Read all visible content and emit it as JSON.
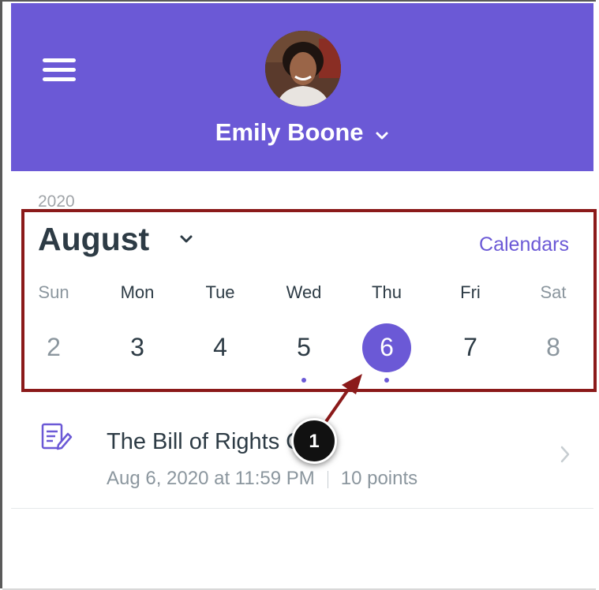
{
  "header": {
    "user_name": "Emily Boone",
    "accent_color": "#6b59d6"
  },
  "calendar": {
    "year": "2020",
    "month": "August",
    "calendars_label": "Calendars",
    "weekdays": [
      "Sun",
      "Mon",
      "Tue",
      "Wed",
      "Thu",
      "Fri",
      "Sat"
    ],
    "days": [
      "2",
      "3",
      "4",
      "5",
      "6",
      "7",
      "8"
    ],
    "selected_day": "6",
    "days_with_events": [
      "5",
      "6"
    ]
  },
  "event": {
    "icon": "quiz-icon",
    "title": "The Bill of Rights Quiz",
    "due": "Aug 6, 2020 at 11:59 PM",
    "points": "10 points"
  },
  "annotation": {
    "callout_number": "1",
    "highlight_color": "#8b1a1a"
  }
}
